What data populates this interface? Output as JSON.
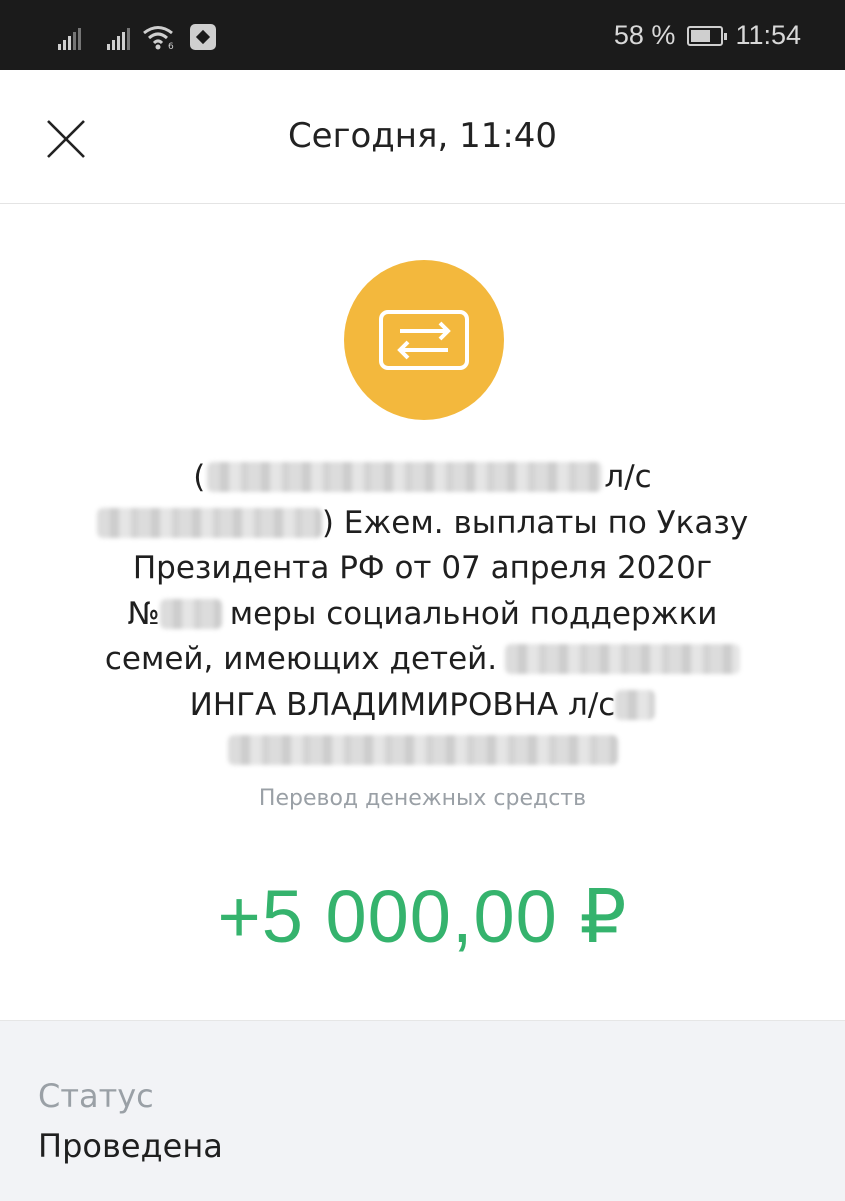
{
  "statusbar": {
    "battery": "58 %",
    "time": "11:54",
    "icons": [
      "signal-icon",
      "signal-icon",
      "wifi-icon",
      "nfc-icon",
      "battery-icon"
    ]
  },
  "header": {
    "title": "Сегодня, 11:40",
    "close_icon": "close-icon"
  },
  "operation": {
    "icon": "transfer-arrows-icon",
    "icon_color": "#f3b83d",
    "description_lines": [
      {
        "prefix": "(",
        "suffix": "л/с"
      },
      {
        "prefix": "",
        "suffix": ") Ежем. выплаты по Указу"
      },
      {
        "prefix": "Президента РФ от 07 апреля 2020г",
        "suffix": ""
      },
      {
        "prefix": "№",
        "suffix": "меры социальной поддержки"
      },
      {
        "prefix": "семей, имеющих детей.",
        "suffix": ""
      },
      {
        "prefix": "ИНГА ВЛАДИМИРОВНА л/с",
        "suffix": ""
      }
    ],
    "type": "Перевод денежных средств",
    "amount": "+5 000,00 ₽",
    "amount_color": "#35b36d"
  },
  "details": {
    "status_label": "Статус",
    "status_value": "Проведена"
  }
}
